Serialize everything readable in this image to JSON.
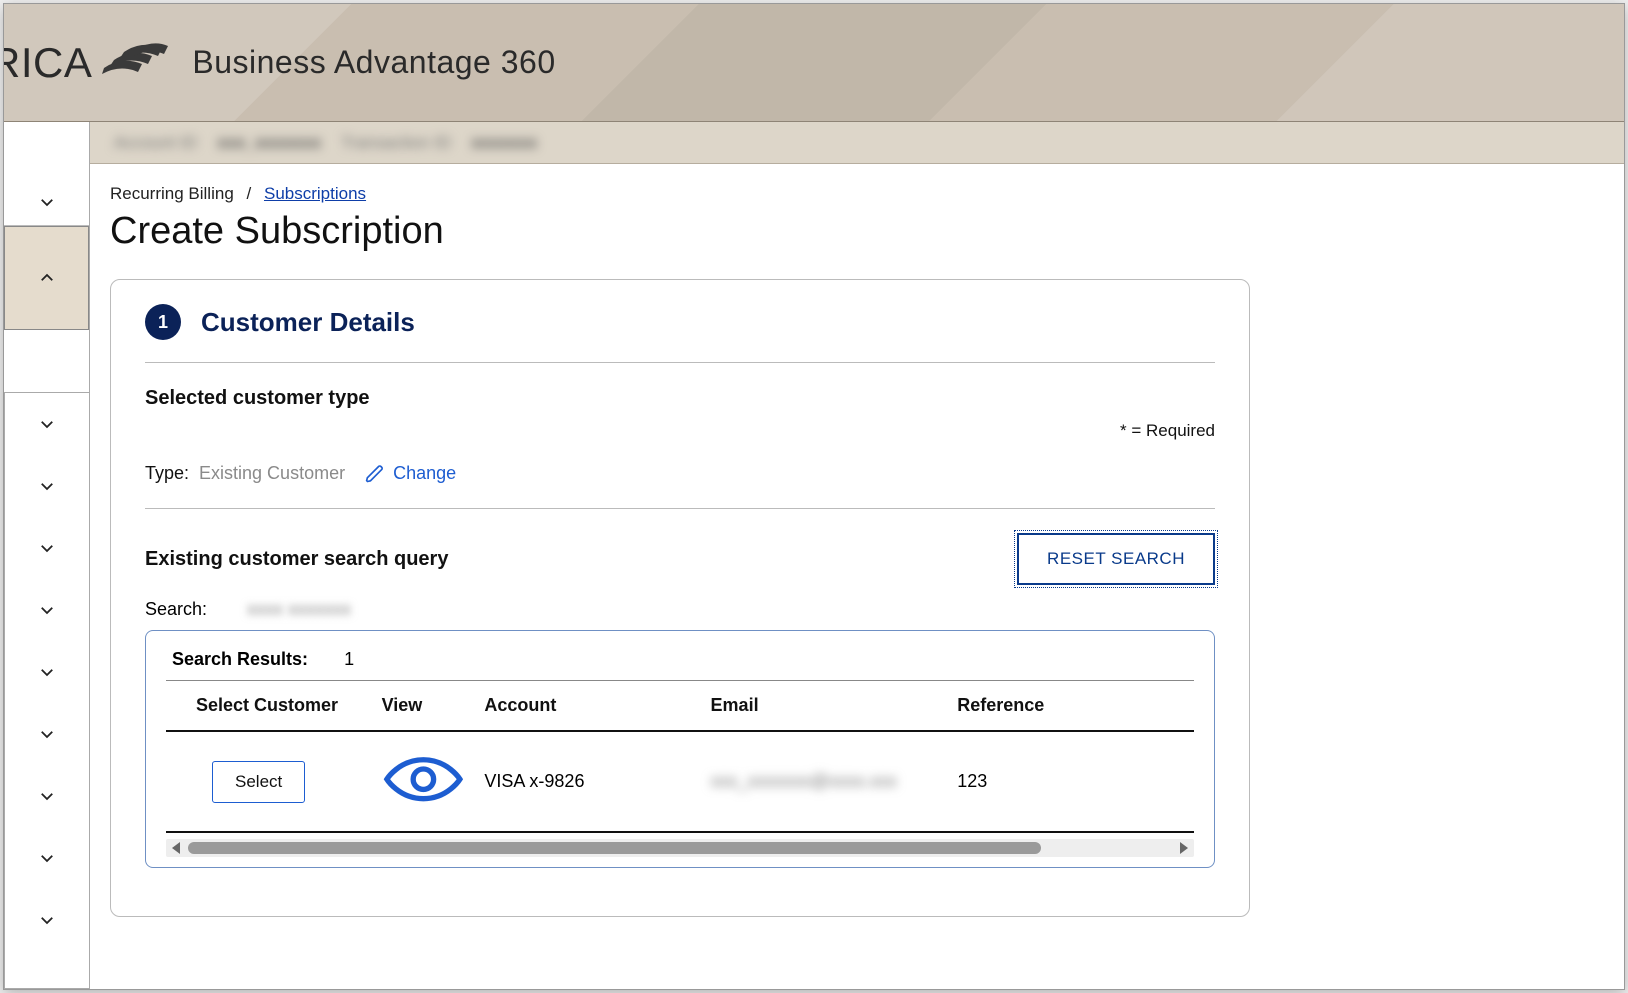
{
  "header": {
    "brand_fragment": "RICA",
    "product_name": "Business Advantage 360"
  },
  "meta": {
    "label1": "Account ID",
    "value1": "xxx_xxxxxxx",
    "label2": "Transaction ID",
    "value2": "xxxxxxx"
  },
  "breadcrumb": {
    "root": "Recurring Billing",
    "current": "Subscriptions"
  },
  "page": {
    "title": "Create Subscription"
  },
  "step": {
    "number": "1",
    "title": "Customer Details"
  },
  "custType": {
    "section_title": "Selected customer type",
    "required_note": "* = Required",
    "type_label": "Type:",
    "type_value": "Existing Customer",
    "change_label": "Change"
  },
  "search": {
    "section_title": "Existing customer search query",
    "reset_label": "RESET SEARCH",
    "search_label": "Search:",
    "search_value": "xxxx xxxxxxx",
    "results_label": "Search Results:",
    "results_count": "1",
    "columns": {
      "select": "Select Customer",
      "view": "View",
      "account": "Account",
      "email": "Email",
      "reference": "Reference"
    },
    "rows": [
      {
        "select_label": "Select",
        "account": "VISA  x-9826",
        "email": "xxx_xxxxxxx@xxxx.xxx",
        "reference": "123"
      }
    ]
  }
}
